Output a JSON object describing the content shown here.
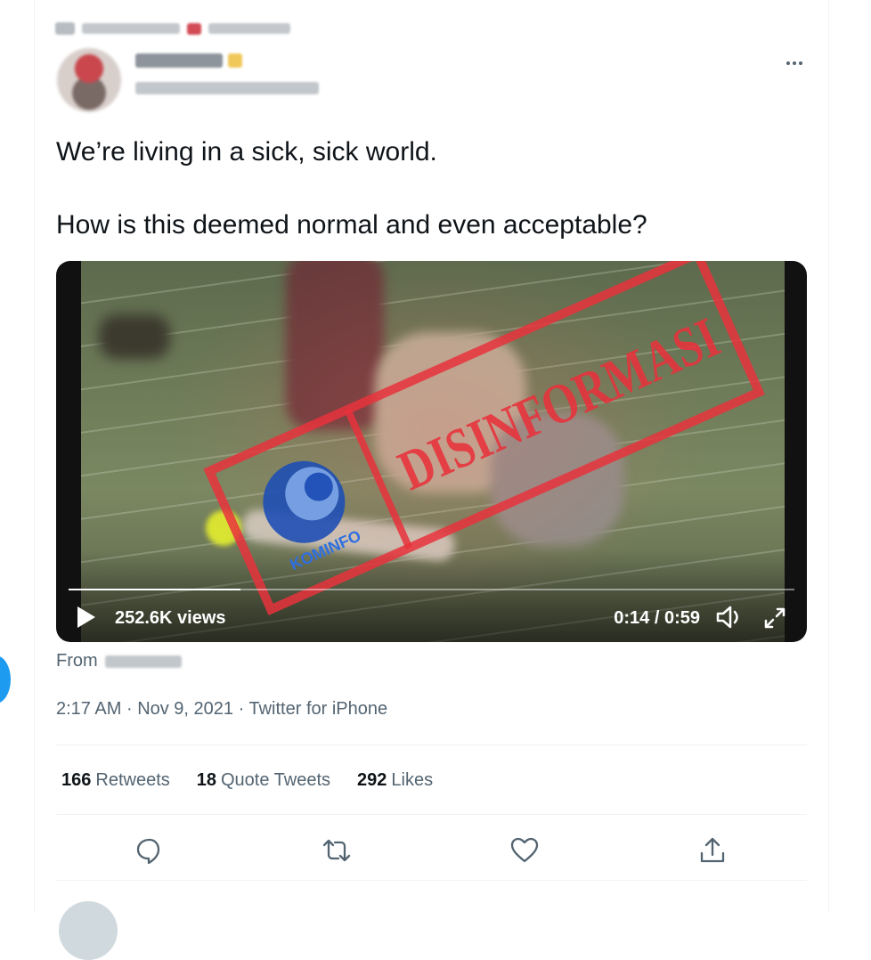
{
  "tweet": {
    "text_line1": "We’re living in a sick, sick world.",
    "text_line2": "How is this deemed normal and even acceptable?"
  },
  "media": {
    "views": "252.6K views",
    "timecode": "0:14 / 0:59",
    "progress": 0.237,
    "stamp_text": "DISINFORMASI",
    "stamp_logo_text": "KOMINFO"
  },
  "from": {
    "label": "From"
  },
  "meta": {
    "time": "2:17 AM",
    "sep1": "·",
    "date": "Nov 9, 2021",
    "sep2": "·",
    "source": "Twitter for iPhone"
  },
  "stats": {
    "retweets_count": "166",
    "retweets_label": "Retweets",
    "quotes_count": "18",
    "quotes_label": "Quote Tweets",
    "likes_count": "292",
    "likes_label": "Likes"
  },
  "icons": {
    "more": "more-icon",
    "play": "play-icon",
    "volume": "volume-icon",
    "fullscreen": "fullscreen-icon",
    "reply": "reply-icon",
    "retweet": "retweet-icon",
    "like": "like-icon",
    "share": "share-icon"
  },
  "colors": {
    "accent": "#1d9bf0",
    "stamp": "#e8323c",
    "text_primary": "#0f1419",
    "text_secondary": "#536471"
  }
}
